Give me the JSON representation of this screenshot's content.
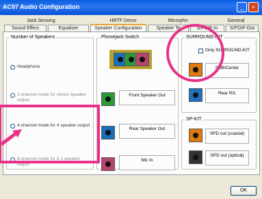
{
  "window": {
    "title": "AC97 Audio Configuration",
    "min_glyph": "_",
    "close_glyph": "×"
  },
  "tabs_row1": [
    {
      "label": "Jack Sensing"
    },
    {
      "label": "HRTF Demo"
    },
    {
      "label": "Micropho"
    },
    {
      "label": "General"
    }
  ],
  "tabs_row2": [
    {
      "label": "Sound Effect"
    },
    {
      "label": "Equalizer"
    },
    {
      "label": "Speaker Configuration"
    },
    {
      "label": "Speaker Te"
    },
    {
      "label": "S/PDIF-In"
    },
    {
      "label": "S/PDIF-Out"
    }
  ],
  "speakers": {
    "group_label": "Number of Speakers",
    "options": [
      {
        "label": "Headphone"
      },
      {
        "label": "2-channel mode for stereo speaker output"
      },
      {
        "label": "4-channel mode for 4 speaker output"
      },
      {
        "label": "6-channel mode for 5.1 speaker output"
      }
    ]
  },
  "phonejack": {
    "group_label": "Phonejack Switch",
    "jacks": [
      {
        "label": "Front Speaker Out",
        "color": "#2a9a3a"
      },
      {
        "label": "Rear Speaker Out",
        "color": "#1a70b8"
      },
      {
        "label": "Mic In",
        "color": "#b5456b"
      }
    ]
  },
  "surround": {
    "group_label": "SURROUND-KIT",
    "checkbox_label": "Only SURROUND-KIT",
    "items": [
      {
        "label": "SUB/Center",
        "color": "#e07a10"
      },
      {
        "label": "Rear R/L",
        "color": "#2070c0"
      }
    ]
  },
  "spkit": {
    "group_label": "SP-KIT",
    "items": [
      {
        "label": "SPD out (coaxial)",
        "color": "#e07a10"
      },
      {
        "label": "SPD out (optical)",
        "color": "#333333"
      }
    ]
  },
  "footer": {
    "ok_label": "OK"
  },
  "colors": {
    "highlight": "#e8318a",
    "title_blue": "#0a5fe0"
  }
}
